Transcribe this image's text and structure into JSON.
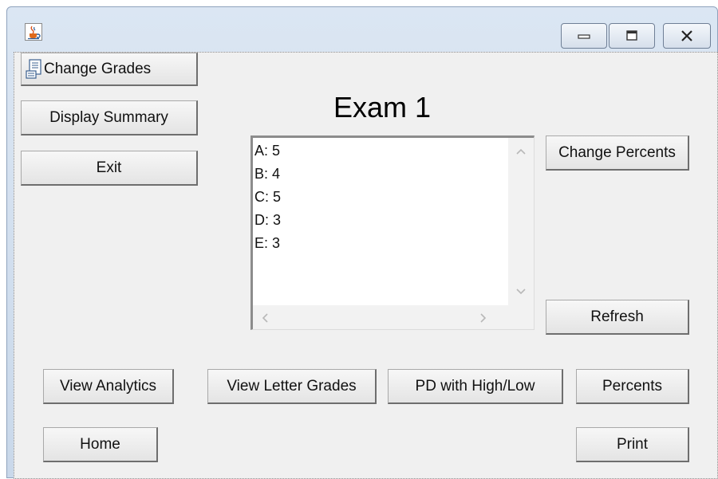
{
  "window": {
    "app_icon": "java-coffee-cup-icon",
    "controls": [
      "minimize-icon",
      "maximize-icon",
      "close-icon"
    ]
  },
  "menu_button": {
    "label": "Change Grades",
    "icon": "document-icon"
  },
  "buttons": {
    "display_summary": "Display Summary",
    "exit": "Exit",
    "change_percents": "Change Percents",
    "refresh": "Refresh",
    "view_analytics": "View Analytics",
    "view_letter_grades": "View Letter Grades",
    "pd_high_low": "PD with High/Low",
    "percents": "Percents",
    "home": "Home",
    "print": "Print"
  },
  "exam_title": "Exam 1",
  "grades": [
    {
      "text": "A: 5"
    },
    {
      "text": "B: 4"
    },
    {
      "text": "C: 5"
    },
    {
      "text": "D: 3"
    },
    {
      "text": "E: 3"
    }
  ],
  "colors": {
    "titlebar": "#c9d8ea",
    "panel": "#f0f0f0"
  }
}
